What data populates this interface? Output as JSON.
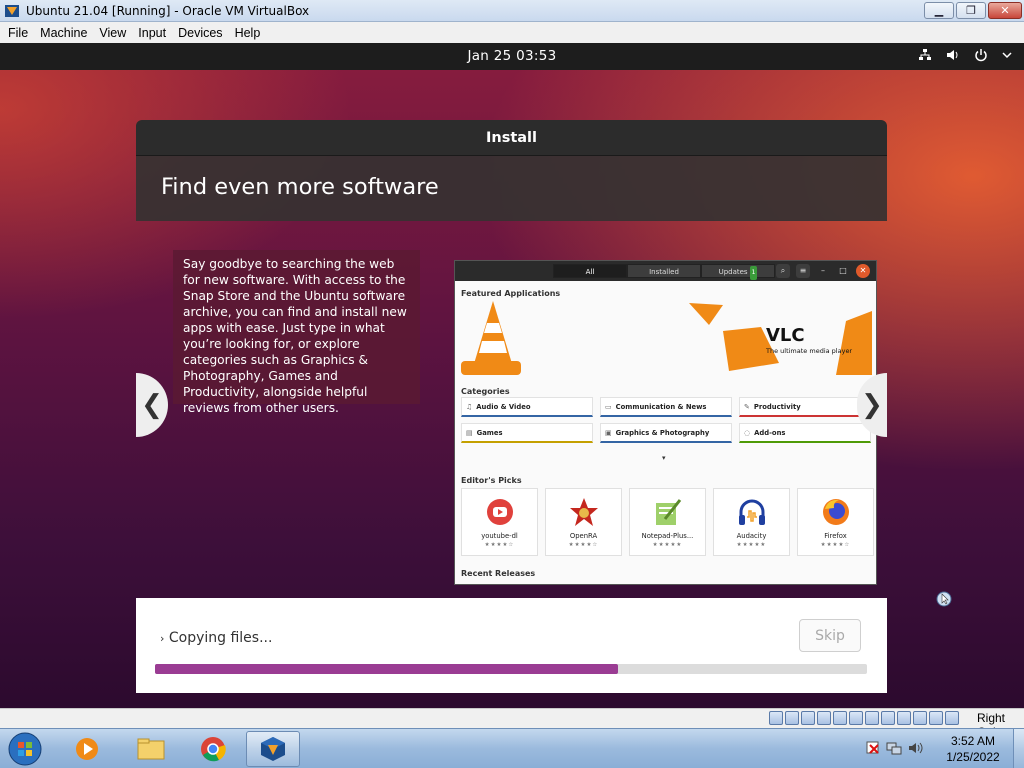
{
  "window": {
    "title": "Ubuntu 21.04 [Running] - Oracle VM VirtualBox",
    "controls": [
      "minimize",
      "restore",
      "close"
    ]
  },
  "menubar": [
    "File",
    "Machine",
    "View",
    "Input",
    "Devices",
    "Help"
  ],
  "gnome_bar": {
    "clock": "Jan 25  03:53",
    "tray_icons": [
      "network-icon",
      "volume-icon",
      "power-icon",
      "chevron-down-icon"
    ]
  },
  "installer": {
    "header": "Install",
    "title": "Find even more software",
    "slide_text": "Say goodbye to searching the web for new software. With access to the Snap Store and the Ubuntu software archive, you can find and install new apps with ease. Just type in what you’re looking for, or explore categories such as Graphics & Photography, Games and Productivity, alongside helpful reviews from other users.",
    "nav_prev": "❮",
    "nav_next": "❯",
    "status": "Copying files...",
    "skip_label": "Skip",
    "progress": 0.65
  },
  "store": {
    "tabs": [
      {
        "label": "All",
        "active": true
      },
      {
        "label": "Installed",
        "active": false
      },
      {
        "label": "Updates",
        "active": false,
        "badge": "1"
      }
    ],
    "featured_heading": "Featured Applications",
    "featured_title": "VLC",
    "featured_subtitle": "The ultimate media player",
    "categories_heading": "Categories",
    "categories": [
      {
        "label": "Audio & Video",
        "icon": "♫",
        "color": "#3465a4"
      },
      {
        "label": "Communication & News",
        "icon": "▭",
        "color": "#3465a4"
      },
      {
        "label": "Productivity",
        "icon": "✎",
        "color": "#cc3333"
      },
      {
        "label": "Games",
        "icon": "▤",
        "color": "#c4a000"
      },
      {
        "label": "Graphics & Photography",
        "icon": "▣",
        "color": "#3465a4"
      },
      {
        "label": "Add-ons",
        "icon": "◌",
        "color": "#4e9a06"
      }
    ],
    "picks_heading": "Editor's Picks",
    "picks": [
      {
        "name": "youtube-dl",
        "stars": "★★★★☆"
      },
      {
        "name": "OpenRA",
        "stars": "★★★★☆"
      },
      {
        "name": "Notepad-Plus...",
        "stars": "★★★★★"
      },
      {
        "name": "Audacity",
        "stars": "★★★★★"
      },
      {
        "name": "Firefox",
        "stars": "★★★★☆"
      }
    ],
    "recent_heading": "Recent Releases"
  },
  "vb_status": {
    "host_key": "Right Ctrl"
  },
  "taskbar": {
    "apps": [
      "windows-media-player-icon",
      "windows-explorer-icon",
      "chrome-icon",
      "virtualbox-icon"
    ],
    "clock_time": "3:52 AM",
    "clock_date": "1/25/2022"
  },
  "colors": {
    "accent_progress": "#9a3c93",
    "ubuntu_orange": "#e95420"
  }
}
